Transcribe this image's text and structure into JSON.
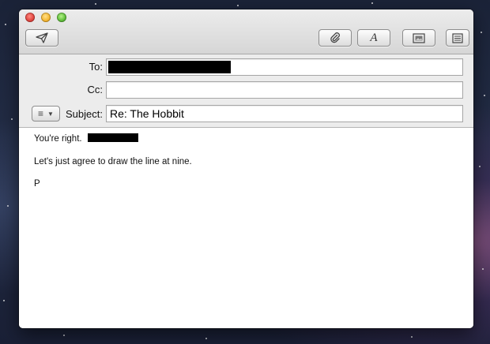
{
  "window": {
    "toolbar": {
      "send_icon": "paper-plane-icon",
      "attach_icon": "paperclip-icon",
      "font_icon": "font-A-icon",
      "font_glyph": "A",
      "photo_icon": "photo-browser-icon",
      "template_icon": "stationery-icon"
    }
  },
  "header": {
    "to_label": "To:",
    "cc_label": "Cc:",
    "subject_label": "Subject:",
    "subject_value": "Re: The Hobbit",
    "format_menu_glyph": "≡",
    "format_menu_caret": "▼"
  },
  "body": {
    "line1": "You're right.",
    "line2": "Let's just agree to draw the line at nine.",
    "line3": "P"
  },
  "colors": {
    "redaction": "#000000",
    "close": "#e0443e",
    "minimize": "#f5b631",
    "zoom": "#5fbe3a"
  }
}
